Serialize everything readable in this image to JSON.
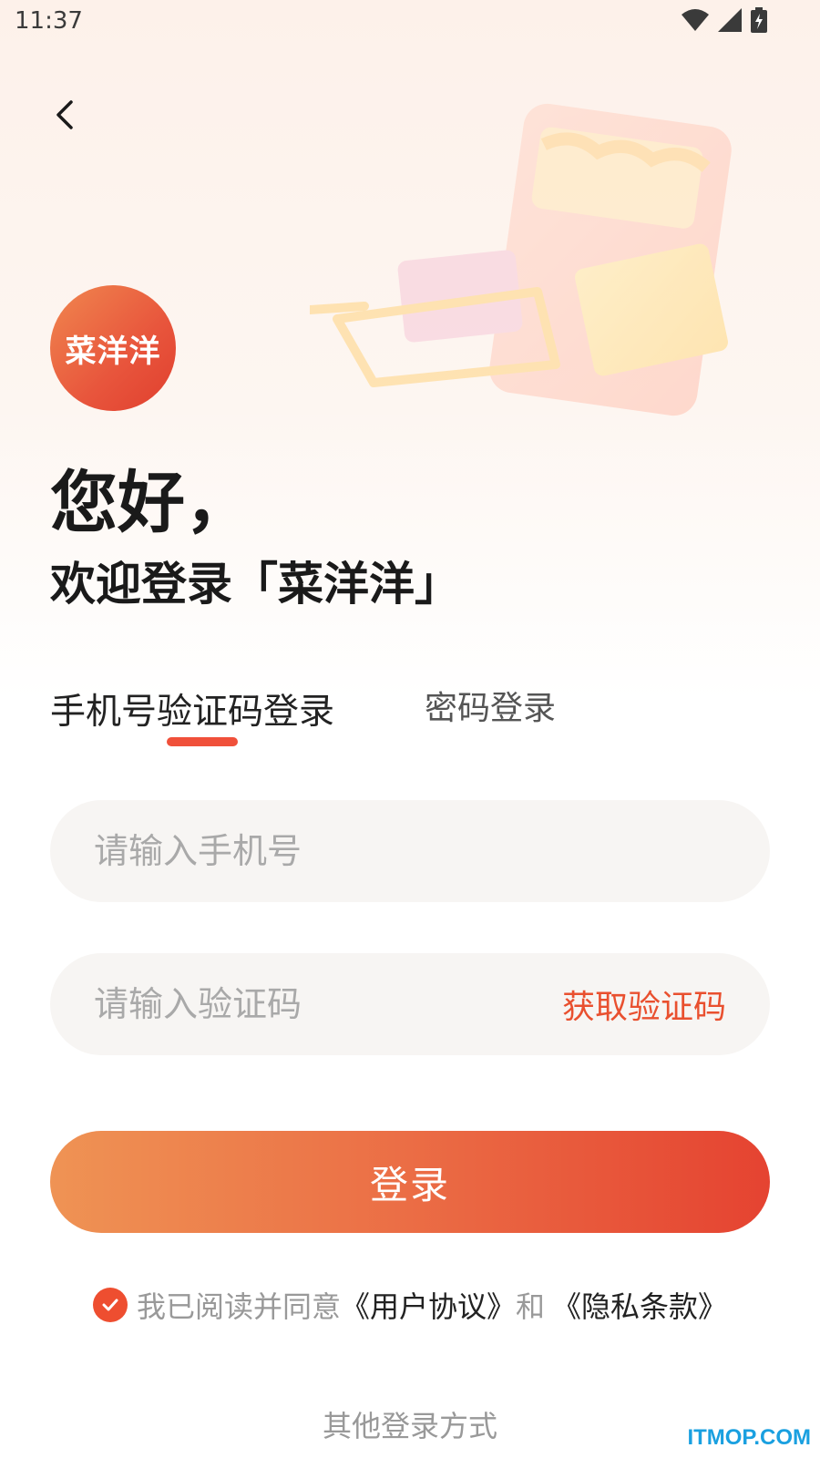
{
  "status_bar": {
    "time": "11:37"
  },
  "logo": {
    "text": "菜洋洋"
  },
  "greeting": {
    "title": "您好，",
    "subtitle": "欢迎登录「菜洋洋」"
  },
  "tabs": {
    "sms_login": "手机号验证码登录",
    "password_login": "密码登录",
    "active": "sms_login"
  },
  "phone_input": {
    "placeholder": "请输入手机号",
    "value": ""
  },
  "code_input": {
    "placeholder": "请输入验证码",
    "value": ""
  },
  "get_code": {
    "label": "获取验证码"
  },
  "login_button": {
    "label": "登录"
  },
  "agreement": {
    "checked": true,
    "prefix": "我已阅读并同意",
    "user_agreement": "《用户协议》",
    "connector": "和",
    "privacy": "《隐私条款》"
  },
  "other_login": {
    "label": "其他登录方式"
  },
  "watermark": "ITMOP.COM",
  "colors": {
    "accent": "#EE4E30",
    "gradient_start": "#EF9354",
    "gradient_end": "#E54331",
    "input_bg": "#F7F5F3"
  },
  "icons": [
    "back-arrow-icon",
    "wifi-icon",
    "signal-icon",
    "battery-icon",
    "checkmark-icon"
  ]
}
